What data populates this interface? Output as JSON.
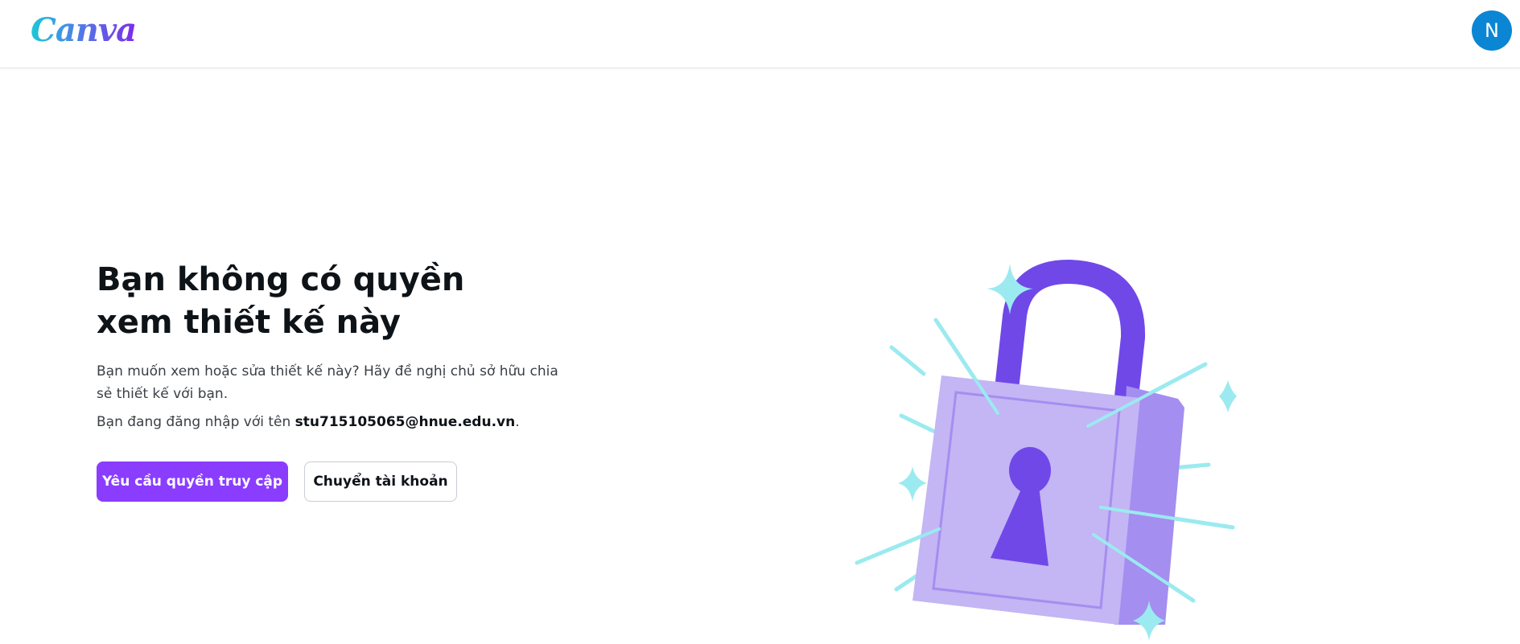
{
  "header": {
    "logo_text": "Canva",
    "avatar_initial": "N"
  },
  "main": {
    "title": "Bạn không có quyền xem thiết kế này",
    "description": "Bạn muốn xem hoặc sửa thiết kế này? Hãy đề nghị chủ sở hữu chia sẻ thiết kế với bạn.",
    "login_prefix": "Bạn đang đăng nhập với tên ",
    "login_email": "stu715105065@hnue.edu.vn",
    "login_suffix": ".",
    "request_access_label": "Yêu cầu quyền truy cập",
    "switch_account_label": "Chuyển tài khoản"
  },
  "colors": {
    "primary_button": "#8b3dff",
    "avatar": "#0b86d4",
    "lock_body": "#c4b5f4",
    "lock_side": "#a48ef0",
    "lock_shackle": "#7048e8",
    "sparkle": "#9beaf0"
  },
  "icons": {
    "illustration": "padlock-illustration"
  }
}
